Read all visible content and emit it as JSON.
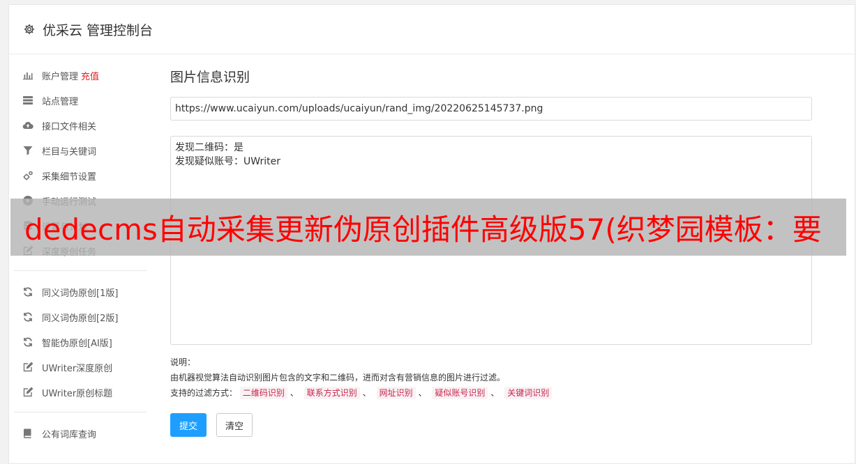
{
  "header": {
    "title": "优采云 管理控制台"
  },
  "sidebar": {
    "group1": [
      {
        "label": "账户管理",
        "badge": "充值",
        "icon": "bar-chart-icon"
      },
      {
        "label": "站点管理",
        "icon": "server-icon"
      },
      {
        "label": "接口文件相关",
        "icon": "cloud-upload-icon"
      },
      {
        "label": "栏目与关键词",
        "icon": "filter-icon"
      },
      {
        "label": "采集细节设置",
        "icon": "gears-icon"
      },
      {
        "label": "手动运行测试",
        "icon": "play-circle-icon"
      },
      {
        "label": "设置与计划",
        "icon": "database-icon"
      },
      {
        "label": "深度原创任务",
        "icon": "edit-icon"
      }
    ],
    "group2": [
      {
        "label": "同义词伪原创[1版]",
        "icon": "refresh-icon"
      },
      {
        "label": "同义词伪原创[2版]",
        "icon": "refresh-icon"
      },
      {
        "label": "智能伪原创[AI版]",
        "icon": "refresh-icon"
      },
      {
        "label": "UWriter深度原创",
        "icon": "edit-icon"
      },
      {
        "label": "UWriter原创标题",
        "icon": "edit-icon"
      }
    ],
    "group3": [
      {
        "label": "公有词库查询",
        "icon": "book-icon"
      }
    ]
  },
  "main": {
    "title": "图片信息识别",
    "url_value": "https://www.ucaiyun.com/uploads/ucaiyun/rand_img/20220625145737.png",
    "result_lines": [
      "发现二维码：是",
      "发现疑似账号：UWriter"
    ],
    "note_heading": "说明：",
    "note_desc": "由机器视觉算法自动识别图片包含的文字和二维码，进而对含有营销信息的图片进行过滤。",
    "filter_label": "支持的过滤方式：",
    "filter_tags": [
      "二维码识别",
      "联系方式识别",
      "网址识别",
      "疑似账号识别",
      "关键词识别"
    ],
    "separator": "、",
    "submit_label": "提交",
    "clear_label": "清空"
  },
  "banner": {
    "text": "dedecms自动采集更新伪原创插件高级版57(织梦园模板：要"
  },
  "colors": {
    "accent": "#1e9fff",
    "danger": "#e02020",
    "tag_text": "#c7254e",
    "tag_bg": "#f9f2f4",
    "banner_text": "#ff0000"
  }
}
